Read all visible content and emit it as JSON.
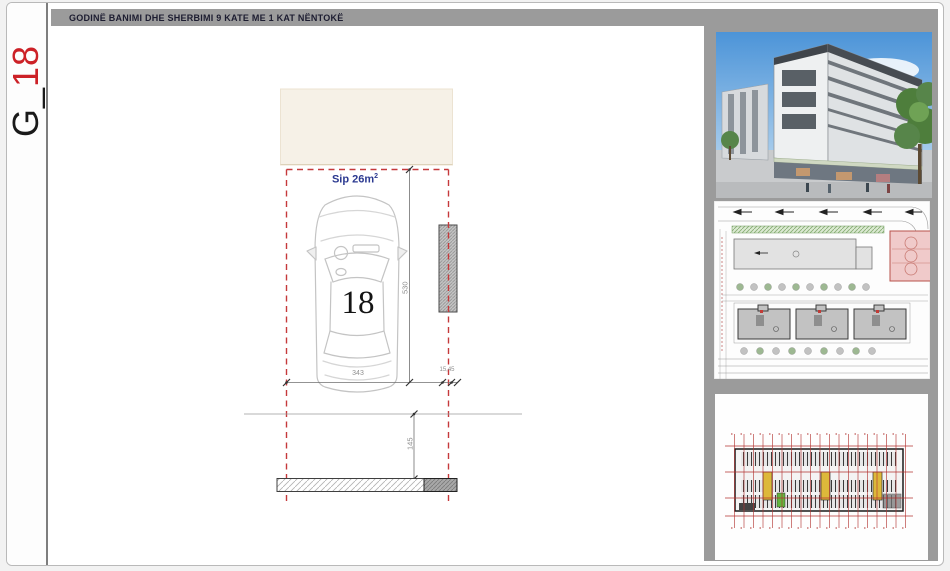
{
  "header": {
    "title": "GODINË BANIMI DHE SHERBIMI 9 KATE ME 1 KAT NËNTOKË"
  },
  "sheet_label": {
    "prefix": "G_",
    "number": "18"
  },
  "parking_space": {
    "area_label": "Sip 26m",
    "area_exponent": "2",
    "space_number": "18",
    "dim_depth": "530",
    "dim_width": "343",
    "dim_column_offsets": "15,45",
    "dim_front_clearance": "145"
  },
  "colors": {
    "accent_red": "#c5393b",
    "annotation_blue": "#2b3990",
    "frame_gray": "#9b9b9b",
    "paper_beige": "#f6f1e7"
  }
}
